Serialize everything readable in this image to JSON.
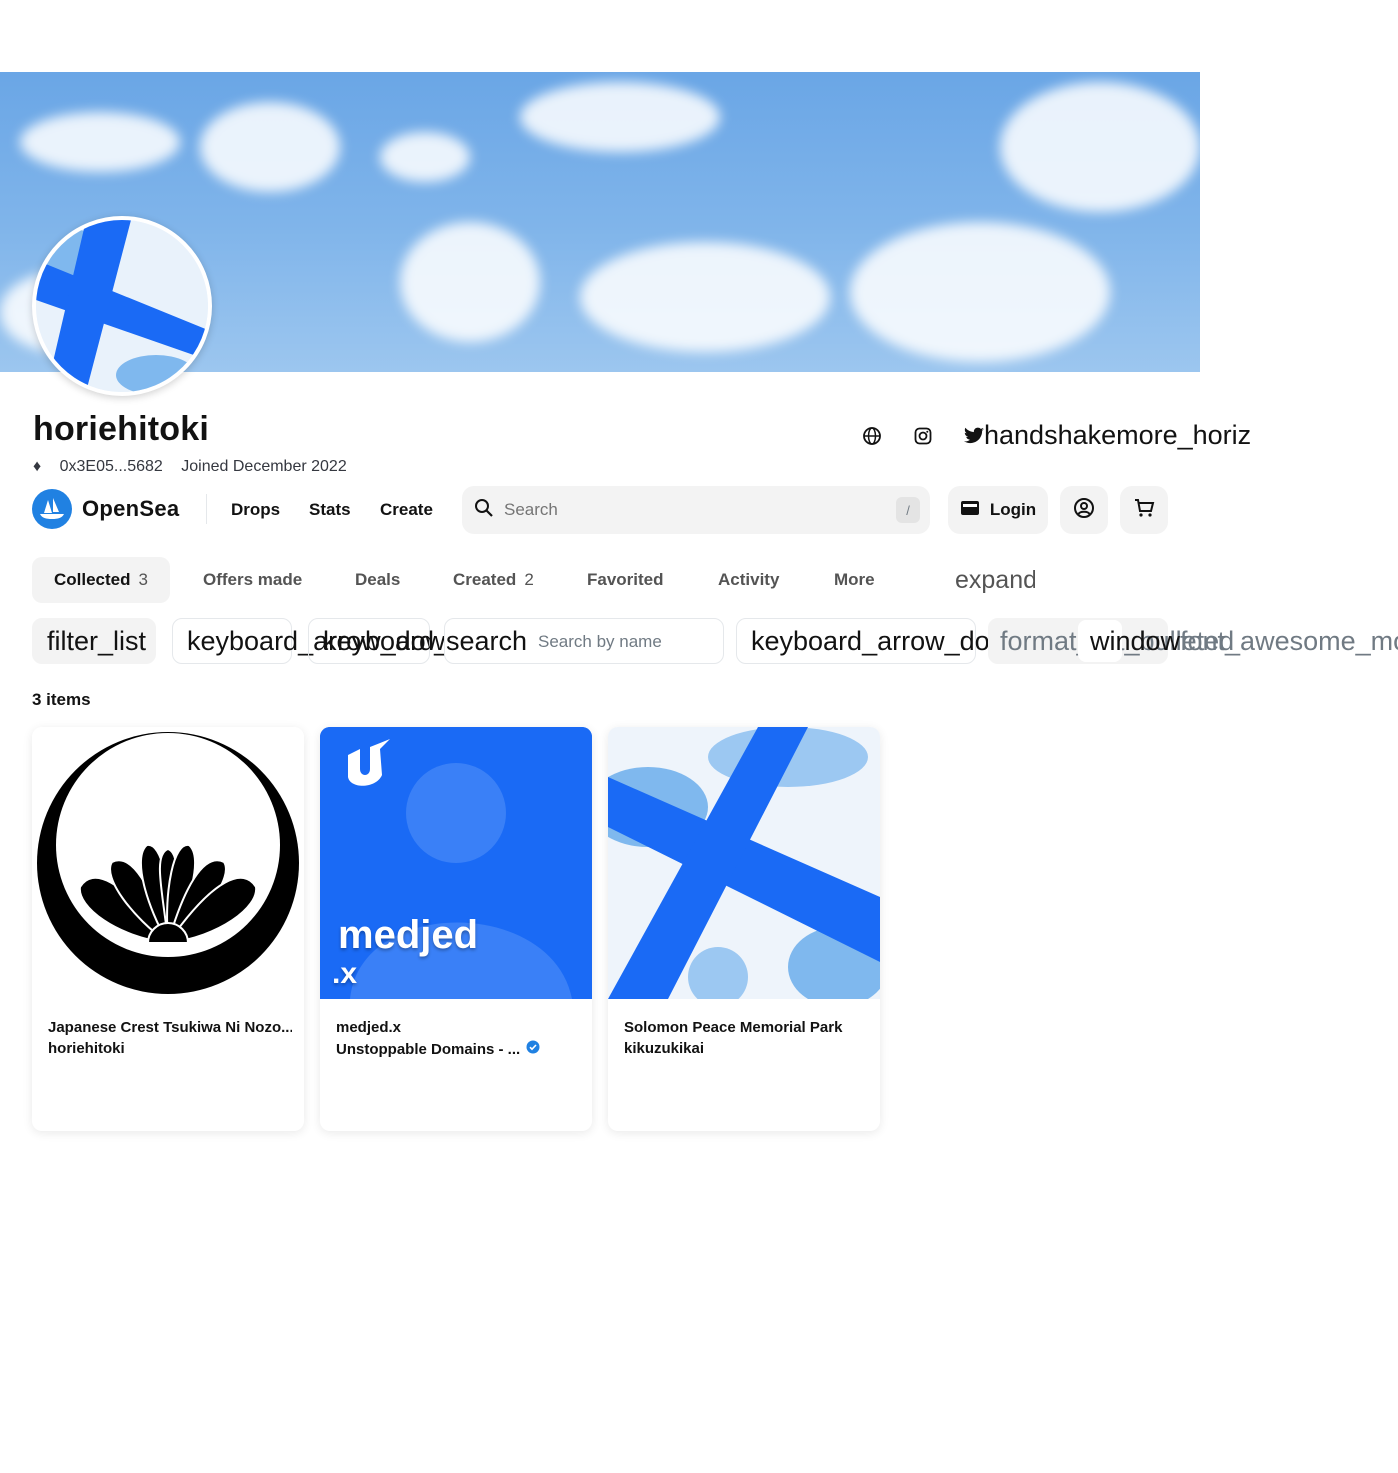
{
  "profile": {
    "username": "horiehitoki",
    "address": "0x3E05...5682",
    "joined": "Joined December 2022",
    "icon_overlay_text": "handshakemore_horiz"
  },
  "nav": {
    "logo_text": "OpenSea",
    "links": [
      "Drops",
      "Stats",
      "Create"
    ],
    "search_placeholder": "Search",
    "search_shortcut": "/",
    "login_label": "Login"
  },
  "tabs": [
    {
      "label": "Collected",
      "count": "3"
    },
    {
      "label": "Offers made",
      "count": ""
    },
    {
      "label": "Deals",
      "count": ""
    },
    {
      "label": "Created",
      "count": "2"
    },
    {
      "label": "Favorited",
      "count": ""
    },
    {
      "label": "Activity",
      "count": ""
    },
    {
      "label": "More",
      "count": ""
    }
  ],
  "tabs_expand_text": "expand_more",
  "filters": {
    "filter_icon_text": "filter_list",
    "dropdown1_text": "keyboard_arrow_down",
    "dropdown2_text": "keyboard_arrow_down",
    "search_icon_text": "search",
    "search_placeholder": "Search by name",
    "sort_text": "keyboard_arrow_down",
    "view_text": "format_list_bulleted",
    "view2_text": "window",
    "view3_text": "font_awesome_mosaic"
  },
  "item_count": "3 items",
  "cards": [
    {
      "title": "Japanese Crest Tsukiwa Ni Nozo...",
      "subtitle": "horiehitoki",
      "verified": false
    },
    {
      "title": "medjed.x",
      "subtitle": "Unstoppable Domains - ...",
      "verified": true,
      "image_text": "medjed",
      "image_text2": ".x"
    },
    {
      "title": "Solomon Peace Memorial Park",
      "subtitle": "kikuzukikai",
      "verified": false
    }
  ],
  "colors": {
    "accent": "#2081e2",
    "banner_sky": "#7fb4ea",
    "medjed_bg": "#1a6af5",
    "verified": "#2081e2"
  }
}
